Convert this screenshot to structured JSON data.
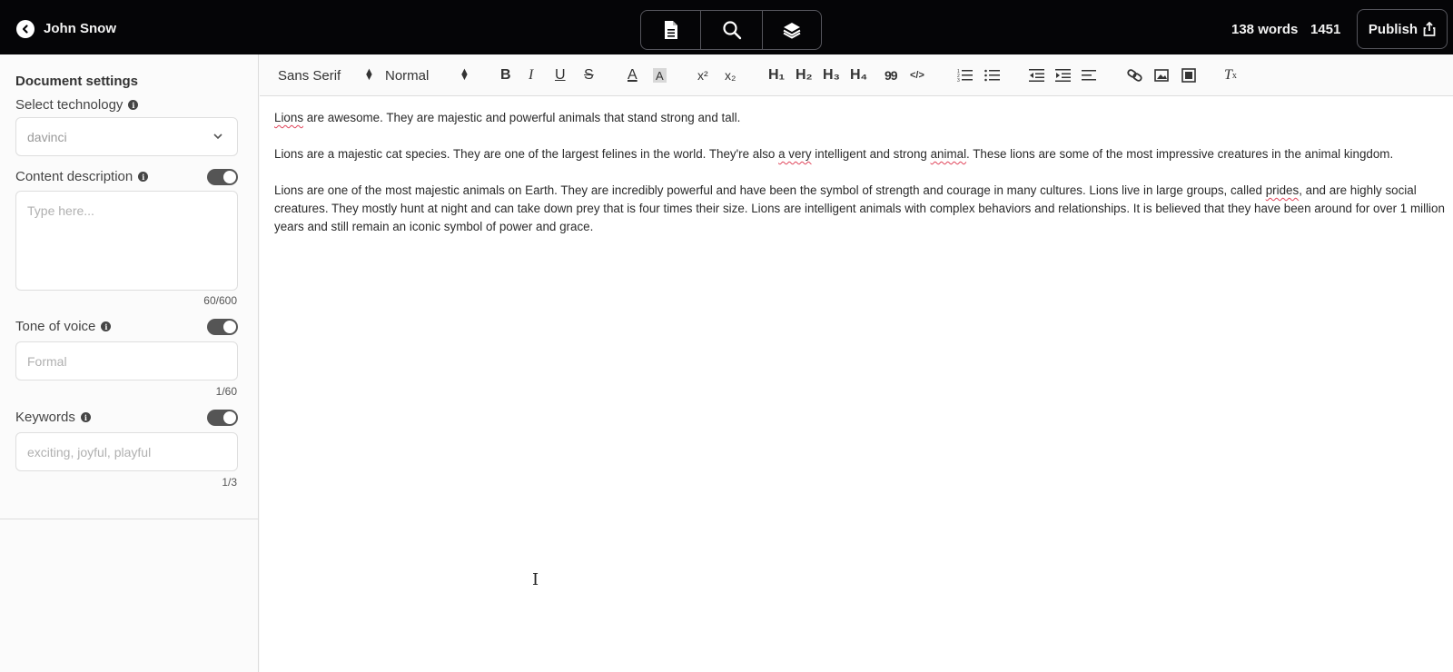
{
  "header": {
    "user_name": "John Snow",
    "words_label": "138 words",
    "chars_label": "1451",
    "publish_label": "Publish",
    "tabs": [
      "document-icon",
      "search-icon",
      "layers-icon"
    ]
  },
  "sidebar": {
    "title": "Document settings",
    "technology": {
      "label": "Select technology",
      "value": "davinci"
    },
    "content_description": {
      "label": "Content description",
      "placeholder": "Type here...",
      "counter": "60/600",
      "enabled": true
    },
    "tone_of_voice": {
      "label": "Tone of voice",
      "placeholder": "Formal",
      "counter": "1/60",
      "enabled": true
    },
    "keywords": {
      "label": "Keywords",
      "placeholder": "exciting, joyful, playful",
      "counter": "1/3",
      "enabled": true
    }
  },
  "toolbar": {
    "font": "Sans Serif",
    "size": "Normal",
    "bold": "B",
    "italic": "I",
    "underline": "U",
    "strike": "S",
    "font_color": "A",
    "highlight": "A",
    "superscript": "x²",
    "subscript": "x₂",
    "h1": "H₁",
    "h2": "H₂",
    "h3": "H₃",
    "h4": "H₄",
    "quote": "99",
    "code": "</>"
  },
  "editor": {
    "p1_a": "Lions",
    "p1_b": " are awesome. They are majestic and powerful animals that stand strong and tall.",
    "p2_a": "Lions are a majestic cat species. They are one of the largest felines in the world. They're also ",
    "p2_b": "a very",
    "p2_c": " intelligent and strong ",
    "p2_d": "animal",
    "p2_e": ". These lions are some of the most impressive creatures in the animal kingdom.",
    "p3_a": "Lions are one of the most majestic animals on Earth. They are incredibly powerful and have been the symbol of strength and courage in many cultures. Lions live in large groups, called ",
    "p3_b": "prides",
    "p3_c": ", and are highly social creatures. They mostly hunt at night and can take down prey that is four times their size. Lions are intelligent animals with complex behaviors and relationships. It is believed that they have been around for over 1 million years and still remain an iconic symbol of power and grace."
  },
  "colors": {
    "topbar": "#050507",
    "toggle": "#555555",
    "spellcheck": "#e0445a"
  }
}
